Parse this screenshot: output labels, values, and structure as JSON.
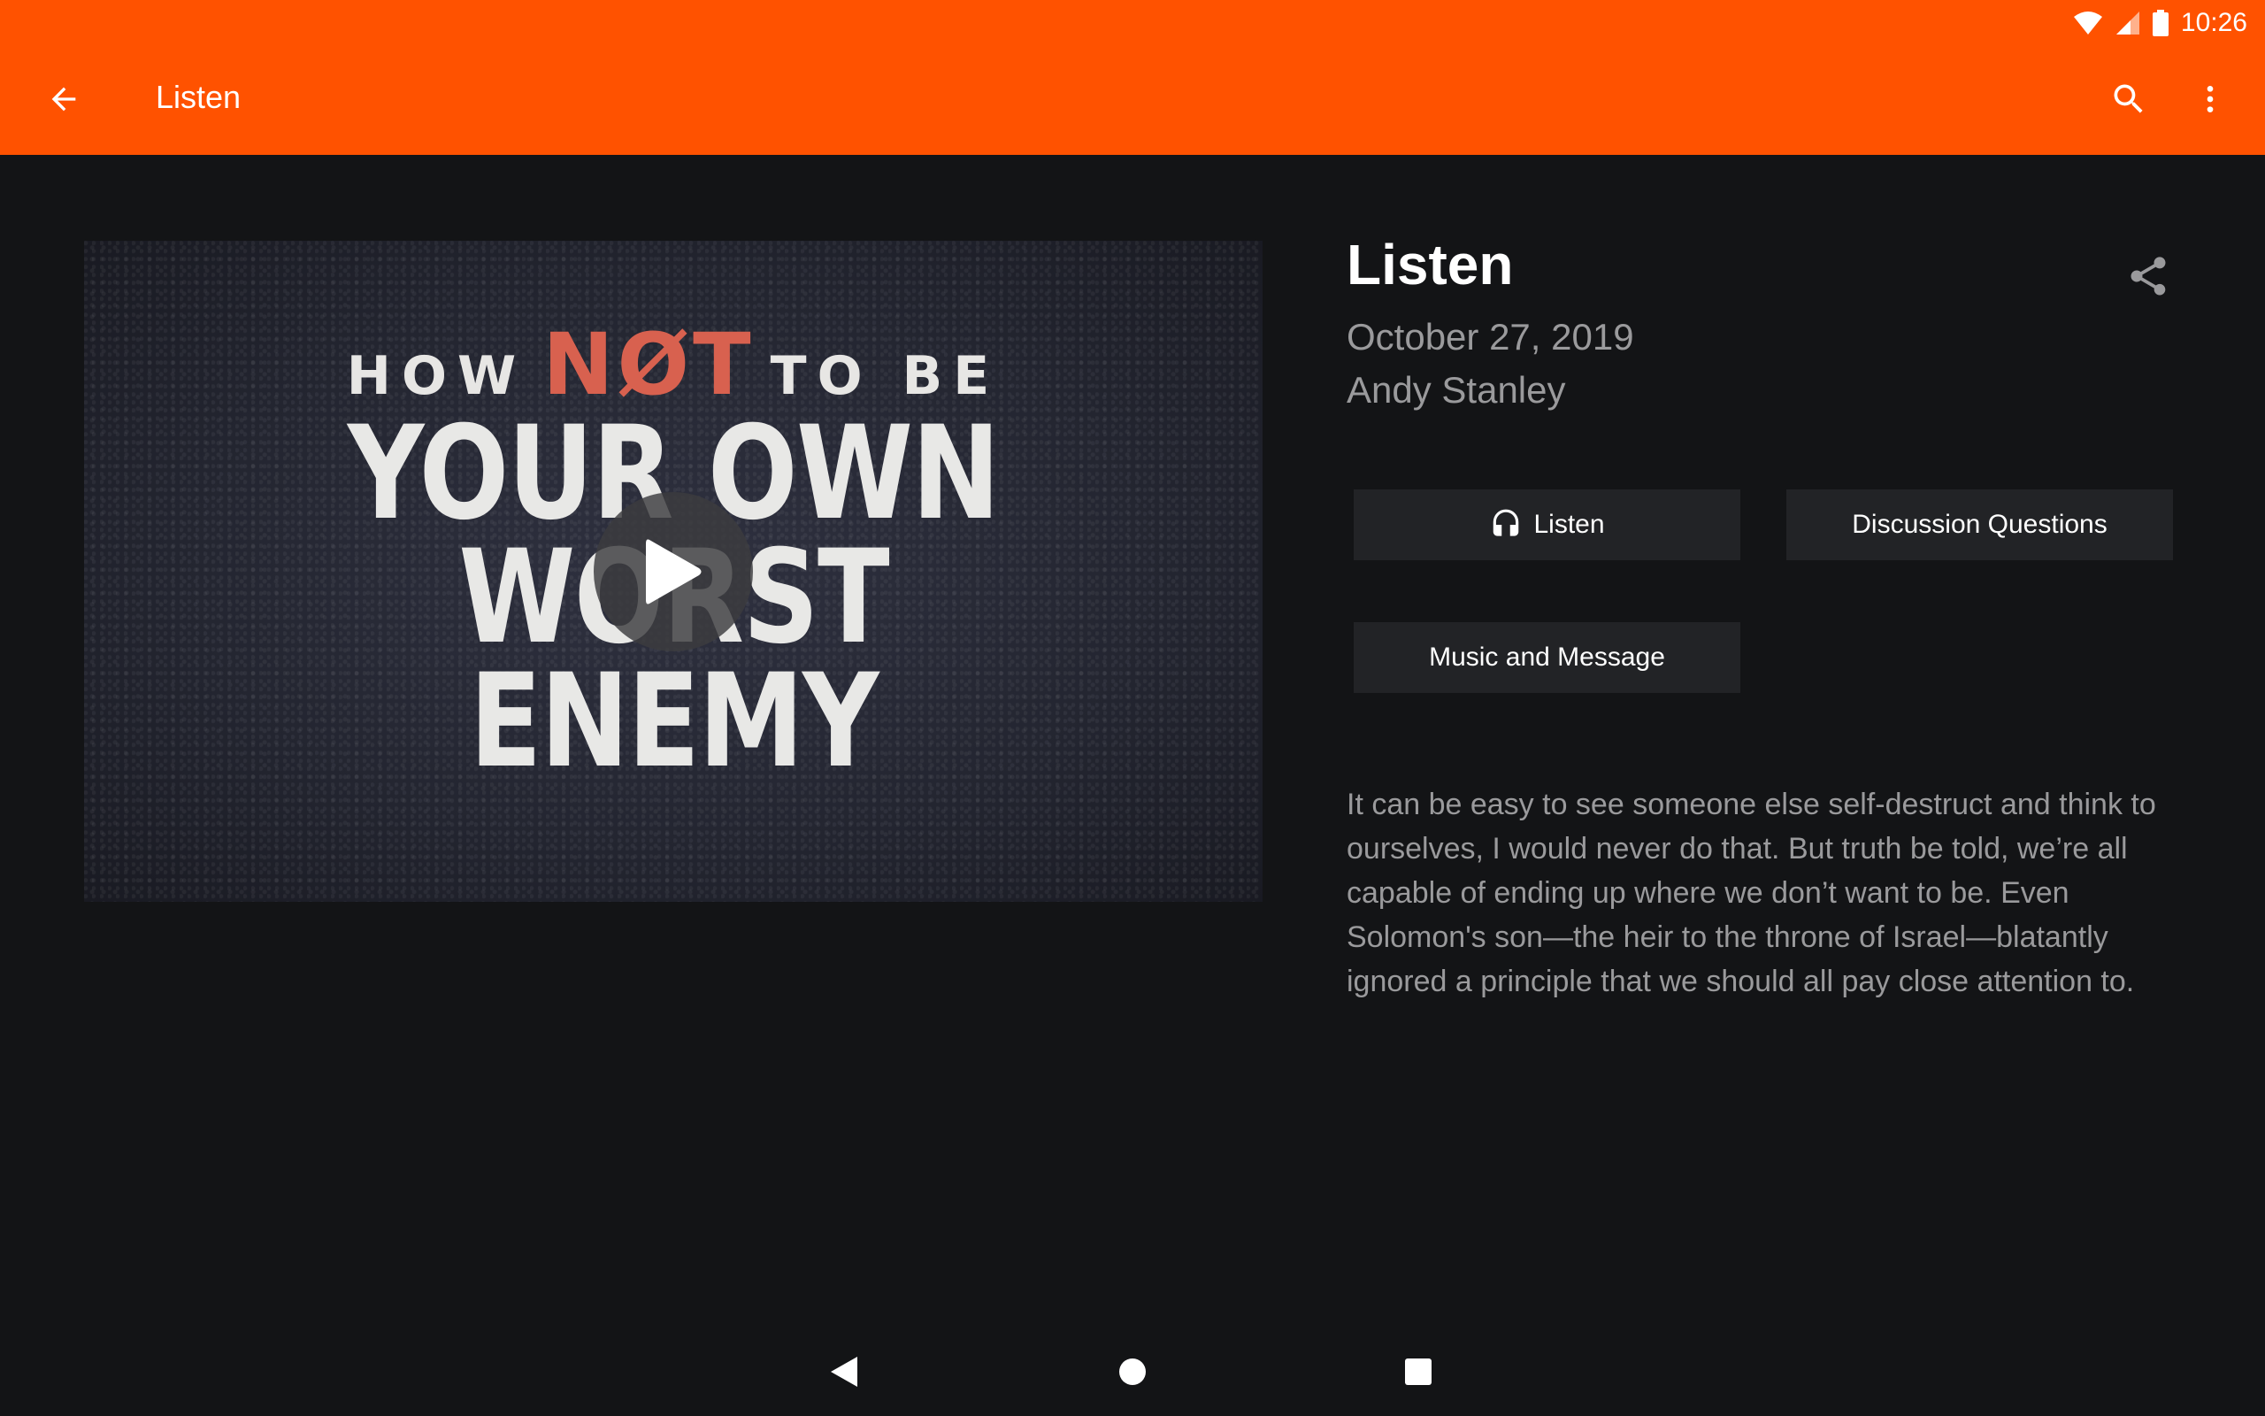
{
  "status_bar": {
    "time": "10:26",
    "icons": [
      "wifi-icon",
      "cell-signal-icon",
      "battery-icon"
    ]
  },
  "toolbar": {
    "title": "Listen",
    "back_icon": "arrow-back-icon",
    "search_icon": "search-icon",
    "more_icon": "more-vert-icon",
    "color": "#ff5200"
  },
  "video": {
    "art_line1_prefix": "HOW",
    "art_line1_not": "NØT",
    "art_line1_suffix": "TO BE",
    "art_line2": "YOUR OWN",
    "art_line3": "WORST",
    "art_line4": "ENEMY",
    "play_icon": "play-icon"
  },
  "details": {
    "title": "Listen",
    "date": "October 27, 2019",
    "speaker": "Andy Stanley",
    "share_icon": "share-icon",
    "buttons": {
      "listen": "Listen",
      "listen_icon": "headphones-icon",
      "discussion": "Discussion Questions",
      "music": "Music and Message"
    },
    "description": "It can be easy to see someone else self-destruct and think to ourselves, I would never do that. But truth be told, we’re all capable of ending up where we don’t want to be. Even Solomon's son—the heir to the throne of Israel—blatantly ignored a principle that we should all pay close attention to."
  },
  "nav_bar": {
    "icons": [
      "nav-back-icon",
      "nav-home-icon",
      "nav-recents-icon"
    ]
  }
}
